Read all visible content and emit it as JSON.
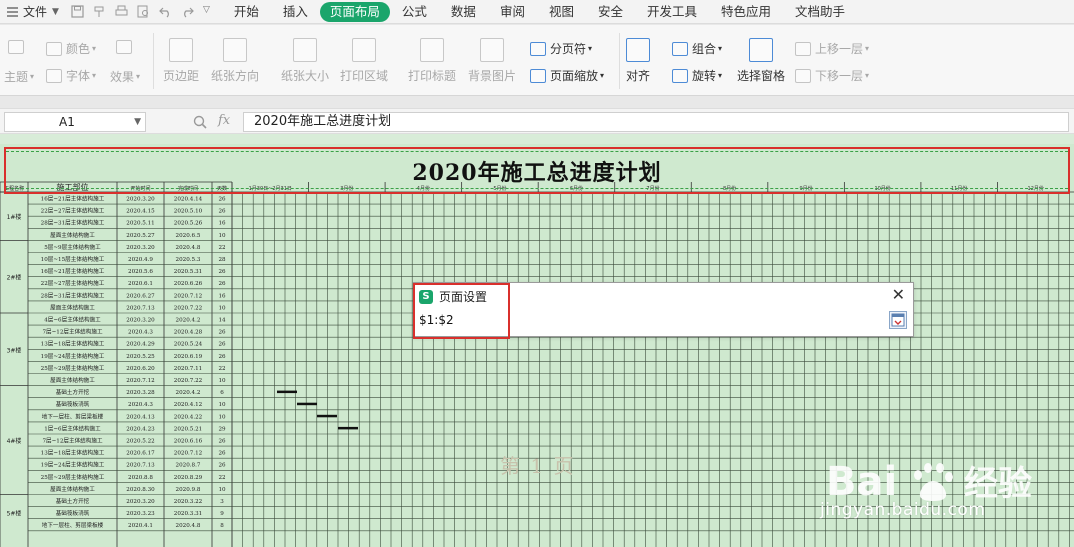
{
  "menubar": {
    "file_label": "文件",
    "tabs": [
      "开始",
      "插入",
      "页面布局",
      "公式",
      "数据",
      "审阅",
      "视图",
      "安全",
      "开发工具",
      "特色应用",
      "文档助手"
    ],
    "active_tab": "页面布局"
  },
  "ribbon": {
    "theme": "主题",
    "color": "颜色",
    "font": "字体",
    "effect": "效果",
    "margins": "页边距",
    "orientation": "纸张方向",
    "size": "纸张大小",
    "print_area": "打印区域",
    "print_titles": "打印标题",
    "background": "背景图片",
    "page_break": "分页符",
    "page_zoom": "页面缩放",
    "align": "对齐",
    "group": "组合",
    "rotate": "旋转",
    "selection_pane": "选择窗格",
    "bring_forward": "上移一层",
    "send_backward": "下移一层"
  },
  "formula_bar": {
    "name_box": "A1",
    "fx": "fx",
    "content": "2020年施工总进度计划"
  },
  "sheet": {
    "title": "2020年施工总进度计划",
    "header": {
      "col1": "工程名称",
      "col2": "施工部位",
      "col3": "开始时间",
      "col4": "完成时间",
      "col5": "天数",
      "months": [
        "1月30日~2月31日",
        "3月份",
        "4月份",
        "5月份",
        "6月份",
        "7月份",
        "8月份",
        "9月份",
        "10月份",
        "11月份",
        "12月份"
      ]
    },
    "rows": [
      [
        "1#楼",
        "16层~21层主体结构施工",
        "2020.3.20",
        "2020.4.14",
        "26"
      ],
      [
        "",
        "22层~27层主体结构施工",
        "2020.4.15",
        "2020.5.10",
        "26"
      ],
      [
        "",
        "28层~31层主体结构施工",
        "2020.5.11",
        "2020.5.26",
        "16"
      ],
      [
        "",
        "屋面主体结构施工",
        "2020.5.27",
        "2020.6.5",
        "10"
      ],
      [
        "2#楼",
        "5层~9层主体结构施工",
        "2020.3.20",
        "2020.4.8",
        "22"
      ],
      [
        "",
        "10层~15层主体结构施工",
        "2020.4.9",
        "2020.5.3",
        "28"
      ],
      [
        "",
        "16层~21层主体结构施工",
        "2020.5.6",
        "2020.5.31",
        "26"
      ],
      [
        "",
        "22层~27层主体结构施工",
        "2020.6.1",
        "2020.6.26",
        "26"
      ],
      [
        "",
        "28层~31层主体结构施工",
        "2020.6.27",
        "2020.7.12",
        "16"
      ],
      [
        "",
        "屋面主体结构施工",
        "2020.7.13",
        "2020.7.22",
        "10"
      ],
      [
        "3#楼",
        "4层~6层主体结构施工",
        "2020.3.20",
        "2020.4.2",
        "14"
      ],
      [
        "",
        "7层~12层主体结构施工",
        "2020.4.3",
        "2020.4.28",
        "26"
      ],
      [
        "",
        "13层~18层主体结构施工",
        "2020.4.29",
        "2020.5.24",
        "26"
      ],
      [
        "",
        "19层~24层主体结构施工",
        "2020.5.25",
        "2020.6.19",
        "26"
      ],
      [
        "",
        "25层~29层主体结构施工",
        "2020.6.20",
        "2020.7.11",
        "22"
      ],
      [
        "",
        "屋面主体结构施工",
        "2020.7.12",
        "2020.7.22",
        "10"
      ],
      [
        "4#楼",
        "基础土方开挖",
        "2020.3.28",
        "2020.4.2",
        "6"
      ],
      [
        "",
        "基础筏板浇筑",
        "2020.4.3",
        "2020.4.12",
        "10"
      ],
      [
        "",
        "地下一层柱、剪层梁板楼",
        "2020.4.13",
        "2020.4.22",
        "10"
      ],
      [
        "",
        "1层~6层主体结构施工",
        "2020.4.23",
        "2020.5.21",
        "29"
      ],
      [
        "",
        "7层~12层主体结构施工",
        "2020.5.22",
        "2020.6.16",
        "26"
      ],
      [
        "",
        "13层~18层主体结构施工",
        "2020.6.17",
        "2020.7.12",
        "26"
      ],
      [
        "",
        "19层~24层主体结构施工",
        "2020.7.13",
        "2020.8.7",
        "26"
      ],
      [
        "",
        "25层~29层主体结构施工",
        "2020.8.8",
        "2020.8.29",
        "22"
      ],
      [
        "",
        "屋面主体结构施工",
        "2020.8.30",
        "2020.9.8",
        "10"
      ],
      [
        "5#楼",
        "基础土方开挖",
        "2020.3.20",
        "2020.3.22",
        "3"
      ],
      [
        "",
        "基础筏板浇筑",
        "2020.3.23",
        "2020.3.31",
        "9"
      ],
      [
        "",
        "地下一层柱、剪层梁板楼",
        "2020.4.1",
        "2020.4.8",
        "8"
      ]
    ],
    "page_watermark": "第 1 页"
  },
  "dialog": {
    "title": "页面设置",
    "value": "$1:$2",
    "logo": "S"
  },
  "watermark": {
    "brand": "Baidu经验",
    "url": "jingyan.baidu.com"
  }
}
